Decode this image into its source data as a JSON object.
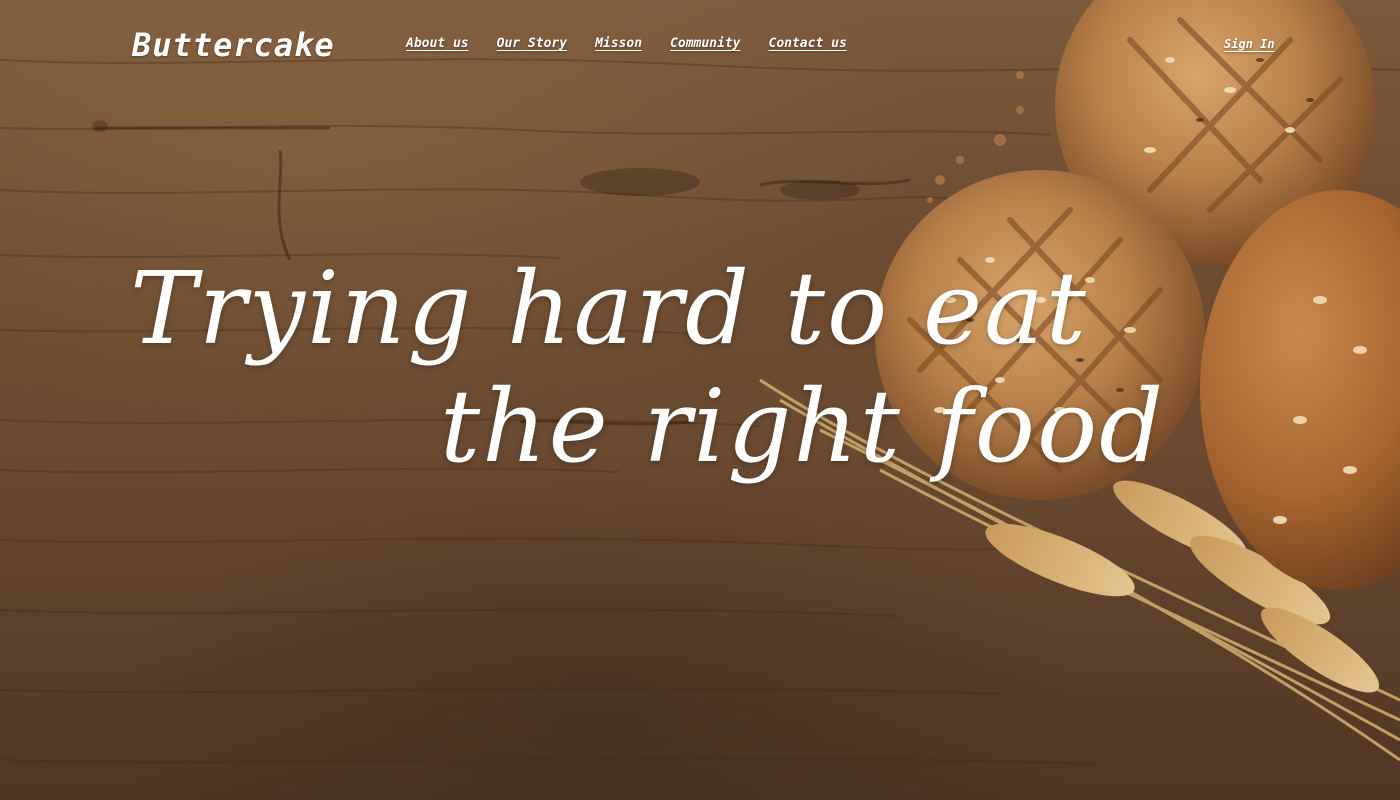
{
  "brand": {
    "logo_text": "Buttercake"
  },
  "nav": {
    "items": [
      {
        "label": "About us"
      },
      {
        "label": "Our Story"
      },
      {
        "label": "Misson"
      },
      {
        "label": "Community"
      },
      {
        "label": "Contact us"
      }
    ],
    "signin_label": "Sign In"
  },
  "hero": {
    "headline_line1": "Trying hard to eat",
    "headline_line2": "the right food"
  },
  "colors": {
    "text": "#ffffff",
    "wood_light": "#7c5a3c",
    "wood_dark": "#4f3623",
    "bread_crust": "#b88450",
    "wheat": "#d9b47a"
  }
}
